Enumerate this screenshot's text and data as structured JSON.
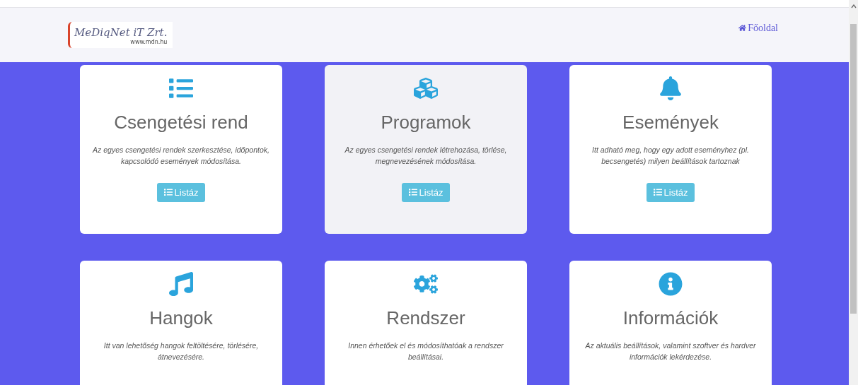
{
  "header": {
    "logo": {
      "text": "MeDiqNet iT Zrt.",
      "url": "www.mdn.hu"
    },
    "nav_link": "Főoldal"
  },
  "cards": [
    {
      "title": "Csengetési rend",
      "description": "Az egyes csengetési rendek szerkesztése, időpontok, kapcsolódó események módosítása.",
      "button": "Listáz",
      "highlighted": false
    },
    {
      "title": "Programok",
      "description": "Az egyes csengetési rendek létrehozása, törlése, megnevezésének módosítása.",
      "button": "Listáz",
      "highlighted": true
    },
    {
      "title": "Események",
      "description": "Itt adható meg, hogy egy adott eseményhez (pl. becsengetés) milyen beállítások tartoznak",
      "button": "Listáz",
      "highlighted": false
    },
    {
      "title": "Hangok",
      "description": "Itt van lehetőség hangok feltöltésére, törlésére, átnevezésére.",
      "highlighted": false
    },
    {
      "title": "Rendszer",
      "description": "Innen érhetőek el és módosíthatóak a rendszer beállításai.",
      "highlighted": false
    },
    {
      "title": "Információk",
      "description": "Az aktuális beállítások, valamint szoftver és hardver információk lekérdezése.",
      "highlighted": false
    }
  ]
}
